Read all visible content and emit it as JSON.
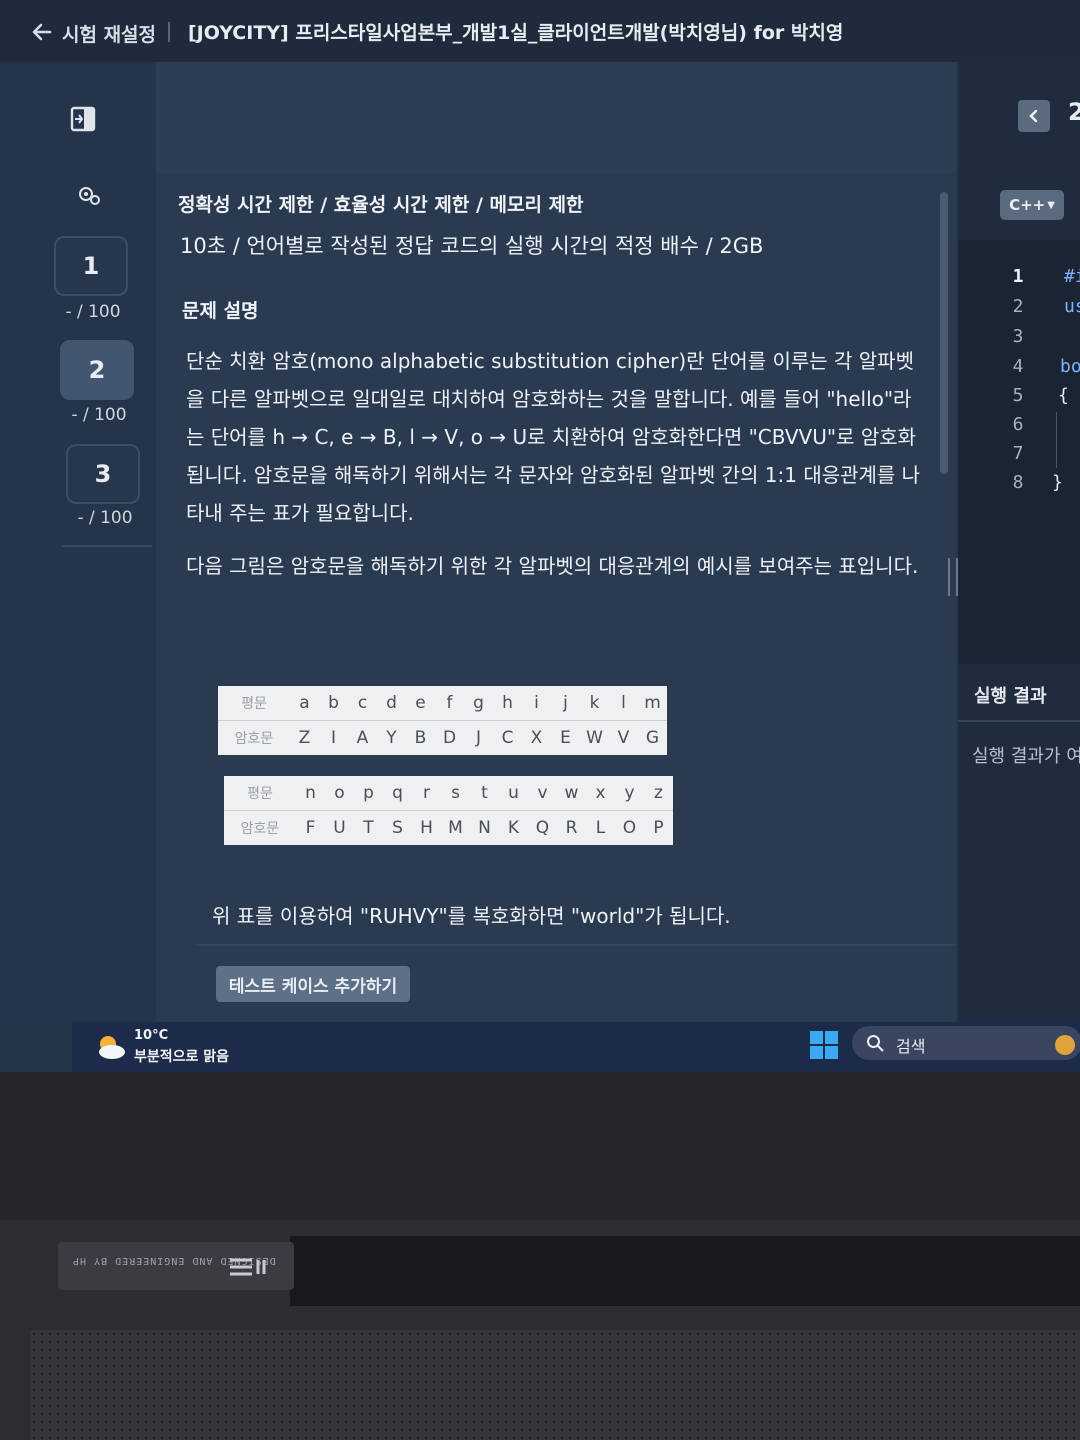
{
  "header": {
    "exit_label": "시험 재설정",
    "exam_title": "[JOYCITY] 프리스타일사업본부_개발1실_클라이언트개발(박치영님) for 박치영"
  },
  "sidebar": {
    "questions": [
      {
        "number": "1",
        "score": "- / 100",
        "active": false
      },
      {
        "number": "2",
        "score": "- / 100",
        "active": true
      },
      {
        "number": "3",
        "score": "- / 100",
        "active": false
      }
    ]
  },
  "problem": {
    "limit_title": "정확성 시간 제한 / 효율성 시간 제한 / 메모리 제한",
    "limit_values": "10초 / 언어별로 작성된 정답 코드의 실행 시간의 적정 배수 / 2GB",
    "desc_title": "문제 설명",
    "para1": "단순 치환 암호(mono alphabetic substitution cipher)란 단어를 이루는 각 알파벳을 다른 알파벳으로 일대일로 대치하여 암호화하는 것을 말합니다. 예를 들어 \"hello\"라는 단어를 h → C, e → B, l → V, o → U로 치환하여 암호화한다면 \"CBVVU\"로 암호화됩니다. 암호문을 해독하기 위해서는 각 문자와 암호화된 알파벳 간의 1:1 대응관계를 나타내 주는 표가 필요합니다.",
    "para2": "다음 그림은 암호문을 해독하기 위한 각 알파벳의 대응관계의 예시를 보여주는 표입니다.",
    "table": {
      "plain_label": "평문",
      "cipher_label": "암호문",
      "plain1": [
        "a",
        "b",
        "c",
        "d",
        "e",
        "f",
        "g",
        "h",
        "i",
        "j",
        "k",
        "l",
        "m"
      ],
      "cipher1": [
        "Z",
        "I",
        "A",
        "Y",
        "B",
        "D",
        "J",
        "C",
        "X",
        "E",
        "W",
        "V",
        "G"
      ],
      "plain2": [
        "n",
        "o",
        "p",
        "q",
        "r",
        "s",
        "t",
        "u",
        "v",
        "w",
        "x",
        "y",
        "z"
      ],
      "cipher2": [
        "F",
        "U",
        "T",
        "S",
        "H",
        "M",
        "N",
        "K",
        "Q",
        "R",
        "L",
        "O",
        "P"
      ]
    },
    "after_table": "위 표를 이용하여 \"RUHVY\"를 복호화하면 \"world\"가 됩니다.",
    "add_testcase_button": "테스트 케이스 추가하기"
  },
  "editor": {
    "page": "2",
    "language": "C++",
    "line_numbers": [
      "1",
      "2",
      "3",
      "4",
      "5",
      "6",
      "7",
      "8"
    ],
    "code": [
      "#i",
      "us",
      "",
      "bo",
      "{",
      "",
      "",
      "}"
    ],
    "result_title": "실행 결과",
    "result_placeholder": "실행 결과가 여"
  },
  "taskbar": {
    "temperature": "10°C",
    "weather": "부분적으로 맑음",
    "search_label": "검색"
  },
  "laptop": {
    "badge_text": "DESIGNED AND ENGINEERED BY HP",
    "badge_logo": "ɪI"
  }
}
